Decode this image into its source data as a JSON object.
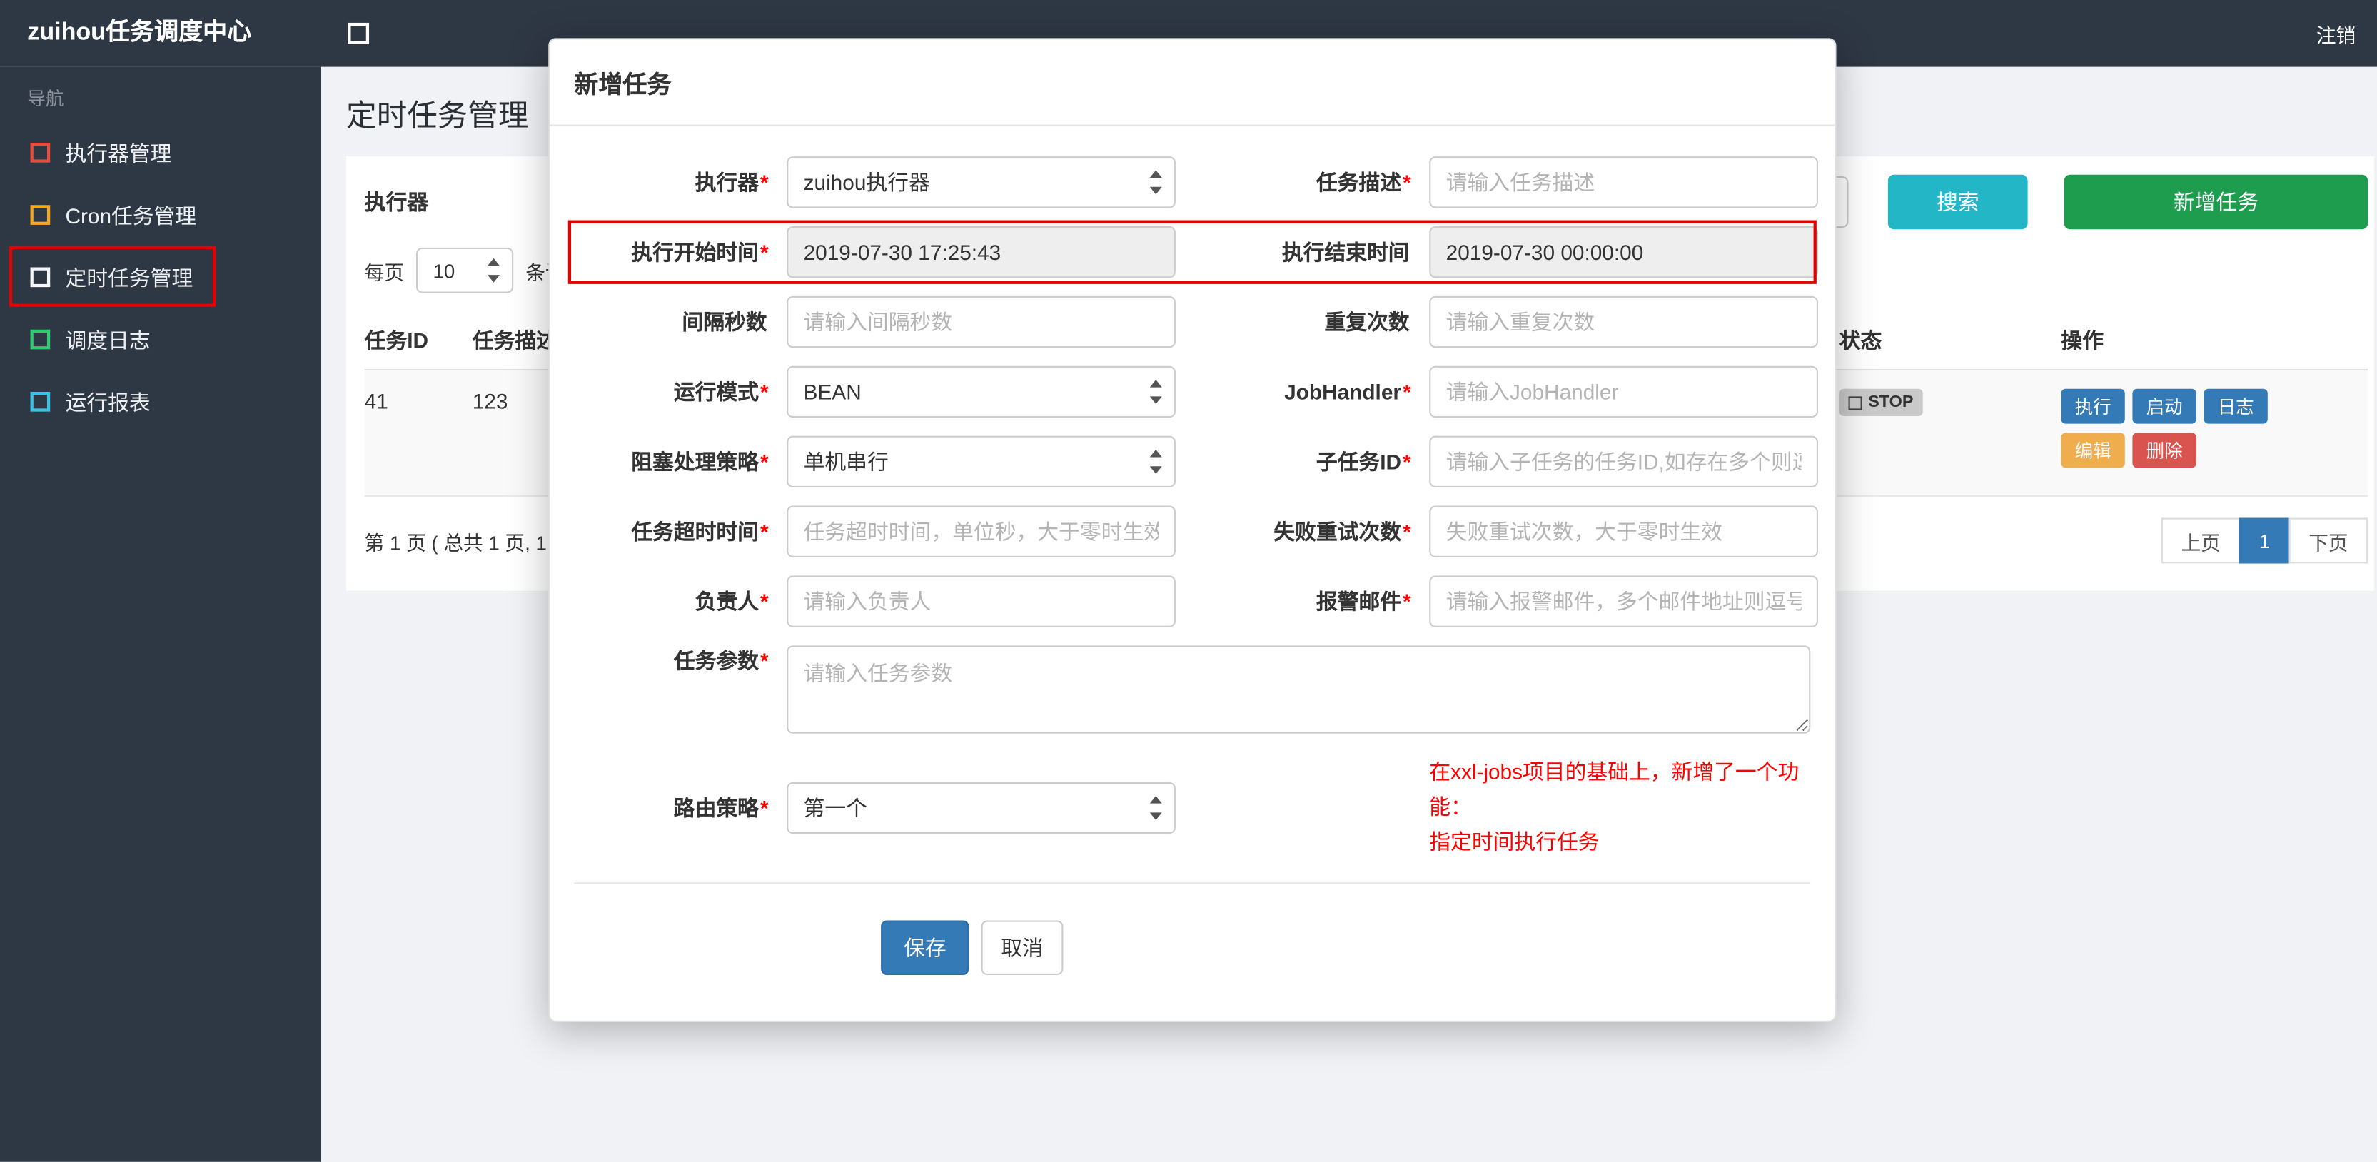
{
  "header": {
    "brand": "zuihou任务调度中心",
    "logout": "注销"
  },
  "sidebar": {
    "nav_label": "导航",
    "items": [
      {
        "label": "执行器管理",
        "icon": "square-icon",
        "icon_color": "#e74c3c"
      },
      {
        "label": "Cron任务管理",
        "icon": "square-icon",
        "icon_color": "#f5a623"
      },
      {
        "label": "定时任务管理",
        "icon": "square-icon",
        "icon_color": "#f5f7fa",
        "active": true
      },
      {
        "label": "调度日志",
        "icon": "square-icon",
        "icon_color": "#2ecc71"
      },
      {
        "label": "运行报表",
        "icon": "square-icon",
        "icon_color": "#3bc1e3"
      }
    ]
  },
  "page": {
    "title": "定时任务管理",
    "filter": {
      "label": "执行器",
      "search": "搜索",
      "add": "新增任务"
    },
    "per_page": {
      "prefix": "每页",
      "value": "10",
      "suffix": "条记"
    },
    "table": {
      "headers": {
        "id": "任务ID",
        "desc": "任务描述",
        "status": "状态",
        "actions": "操作"
      },
      "row": {
        "id": "41",
        "desc": "123",
        "status": "STOP",
        "actions": {
          "run": "执行",
          "start": "启动",
          "log": "日志",
          "edit": "编辑",
          "remove": "删除"
        }
      }
    },
    "pagination": {
      "info": "第 1 页 ( 总共 1 页, 1",
      "prev": "上页",
      "current": "1",
      "next": "下页"
    }
  },
  "modal": {
    "title": "新增任务",
    "rows": [
      {
        "left": {
          "label": "执行器",
          "required": "*",
          "value": "zuihou执行器"
        },
        "right": {
          "label": "任务描述",
          "required": "*",
          "placeholder": "请输入任务描述"
        }
      },
      {
        "left": {
          "label": "执行开始时间",
          "required": "*",
          "value": "2019-07-30 17:25:43"
        },
        "right": {
          "label": "执行结束时间",
          "value": "2019-07-30 00:00:00"
        }
      },
      {
        "left": {
          "label": "间隔秒数",
          "placeholder": "请输入间隔秒数"
        },
        "right": {
          "label": "重复次数",
          "placeholder": "请输入重复次数"
        }
      },
      {
        "left": {
          "label": "运行模式",
          "required": "*",
          "value": "BEAN"
        },
        "right": {
          "label": "JobHandler",
          "required": "*",
          "placeholder": "请输入JobHandler"
        }
      },
      {
        "left": {
          "label": "阻塞处理策略",
          "required": "*",
          "value": "单机串行"
        },
        "right": {
          "label": "子任务ID",
          "required": "*",
          "placeholder": "请输入子任务的任务ID,如存在多个则逗"
        }
      },
      {
        "left": {
          "label": "任务超时时间",
          "required": "*",
          "placeholder": "任务超时时间，单位秒，大于零时生效"
        },
        "right": {
          "label": "失败重试次数",
          "required": "*",
          "placeholder": "失败重试次数，大于零时生效"
        }
      },
      {
        "left": {
          "label": "负责人",
          "required": "*",
          "placeholder": "请输入负责人"
        },
        "right": {
          "label": "报警邮件",
          "required": "*",
          "placeholder": "请输入报警邮件，多个邮件地址则逗号分"
        }
      }
    ],
    "params": {
      "label": "任务参数",
      "required": "*",
      "placeholder": "请输入任务参数"
    },
    "route": {
      "label": "路由策略",
      "required": "*",
      "value": "第一个"
    },
    "note_line1": "在xxl-jobs项目的基础上，新增了一个功能：",
    "note_line2": "指定时间执行任务",
    "save": "保存",
    "cancel": "取消"
  },
  "colors": {
    "topbar_bg": "#2e3744",
    "primary_blue": "#337ab7",
    "search_teal": "#23b6c7",
    "add_green": "#1e9d4f",
    "warning_orange": "#f0ad4e",
    "danger_red": "#d9534f",
    "annotation_red": "#e60000",
    "note_red": "#ff0000"
  }
}
